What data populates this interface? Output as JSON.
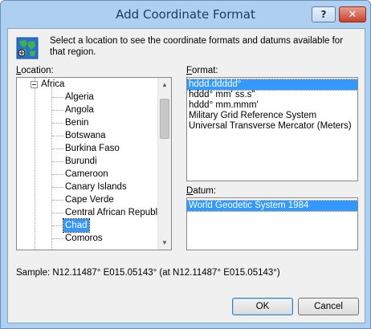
{
  "window": {
    "title": "Add Coordinate Format",
    "help_label": "?",
    "close_label": "✕"
  },
  "intro": "Select a location to see the coordinate formats and datums available for that region.",
  "location": {
    "label_key": "L",
    "label_rest": "ocation:",
    "parent": "Africa",
    "items": [
      "Algeria",
      "Angola",
      "Benin",
      "Botswana",
      "Burkina Faso",
      "Burundi",
      "Cameroon",
      "Canary Islands",
      "Cape Verde",
      "Central African Republic",
      "Chad",
      "Comoros"
    ],
    "selected": "Chad"
  },
  "format": {
    "label_key": "F",
    "label_rest": "ormat:",
    "items": [
      "hddd.ddddd°",
      "hddd° mm' ss.s\"",
      "hddd° mm.mmm'",
      "Military Grid Reference System",
      "Universal Transverse Mercator (Meters)"
    ],
    "selected": "hddd.ddddd°"
  },
  "datum": {
    "label_key": "D",
    "label_rest": "atum:",
    "items": [
      "World Geodetic System 1984"
    ],
    "selected": "World Geodetic System 1984"
  },
  "sample": "Sample: N12.11487° E015.05143° (at N12.11487° E015.05143°)",
  "buttons": {
    "ok": "OK",
    "cancel": "Cancel"
  },
  "colors": {
    "selection": "#3399ff",
    "frame": "#aed0f0",
    "close_button": "#c8402c"
  }
}
